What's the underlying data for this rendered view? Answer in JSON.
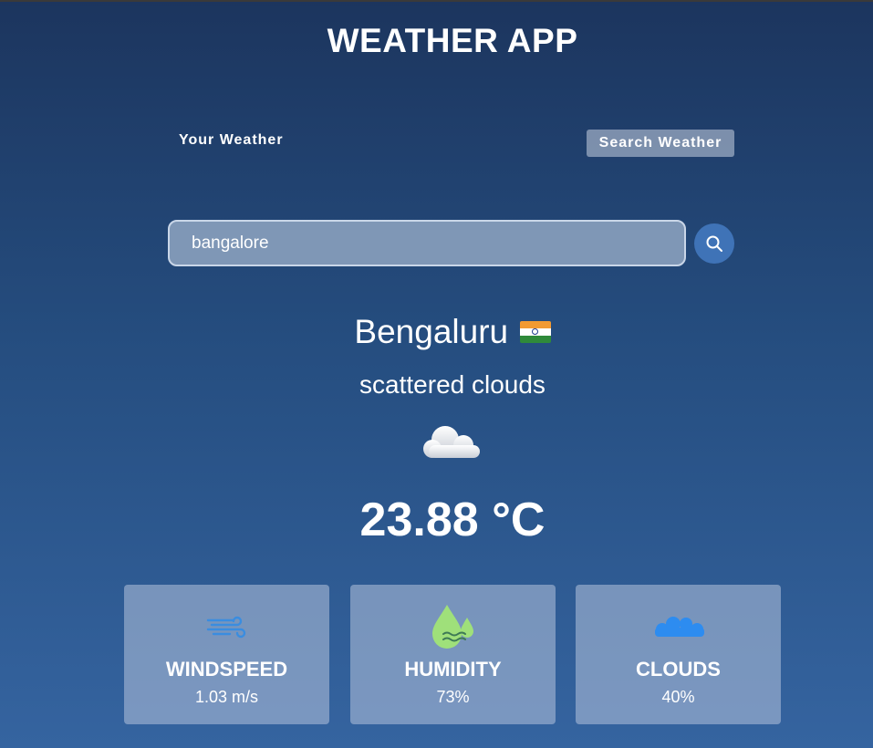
{
  "app": {
    "title": "WEATHER APP"
  },
  "tabs": {
    "your_weather": "Your Weather",
    "search_weather": "Search Weather"
  },
  "search": {
    "value": "bangalore"
  },
  "weather": {
    "city": "Bengaluru",
    "country_flag": "india-flag",
    "description": "scattered clouds",
    "icon": "scattered-clouds-icon",
    "temperature": "23.88 °C"
  },
  "stats": {
    "windspeed": {
      "label": "WINDSPEED",
      "value": "1.03 m/s",
      "icon": "wind-icon"
    },
    "humidity": {
      "label": "HUMIDITY",
      "value": "73%",
      "icon": "humidity-drop-icon"
    },
    "clouds": {
      "label": "CLOUDS",
      "value": "40%",
      "icon": "cloud-icon"
    }
  },
  "colors": {
    "background_top": "#1c355e",
    "background_bottom": "#3564a0",
    "accent": "#3f73b7",
    "humidity_icon": "#9fe07a",
    "clouds_icon": "#2d8cf0"
  }
}
